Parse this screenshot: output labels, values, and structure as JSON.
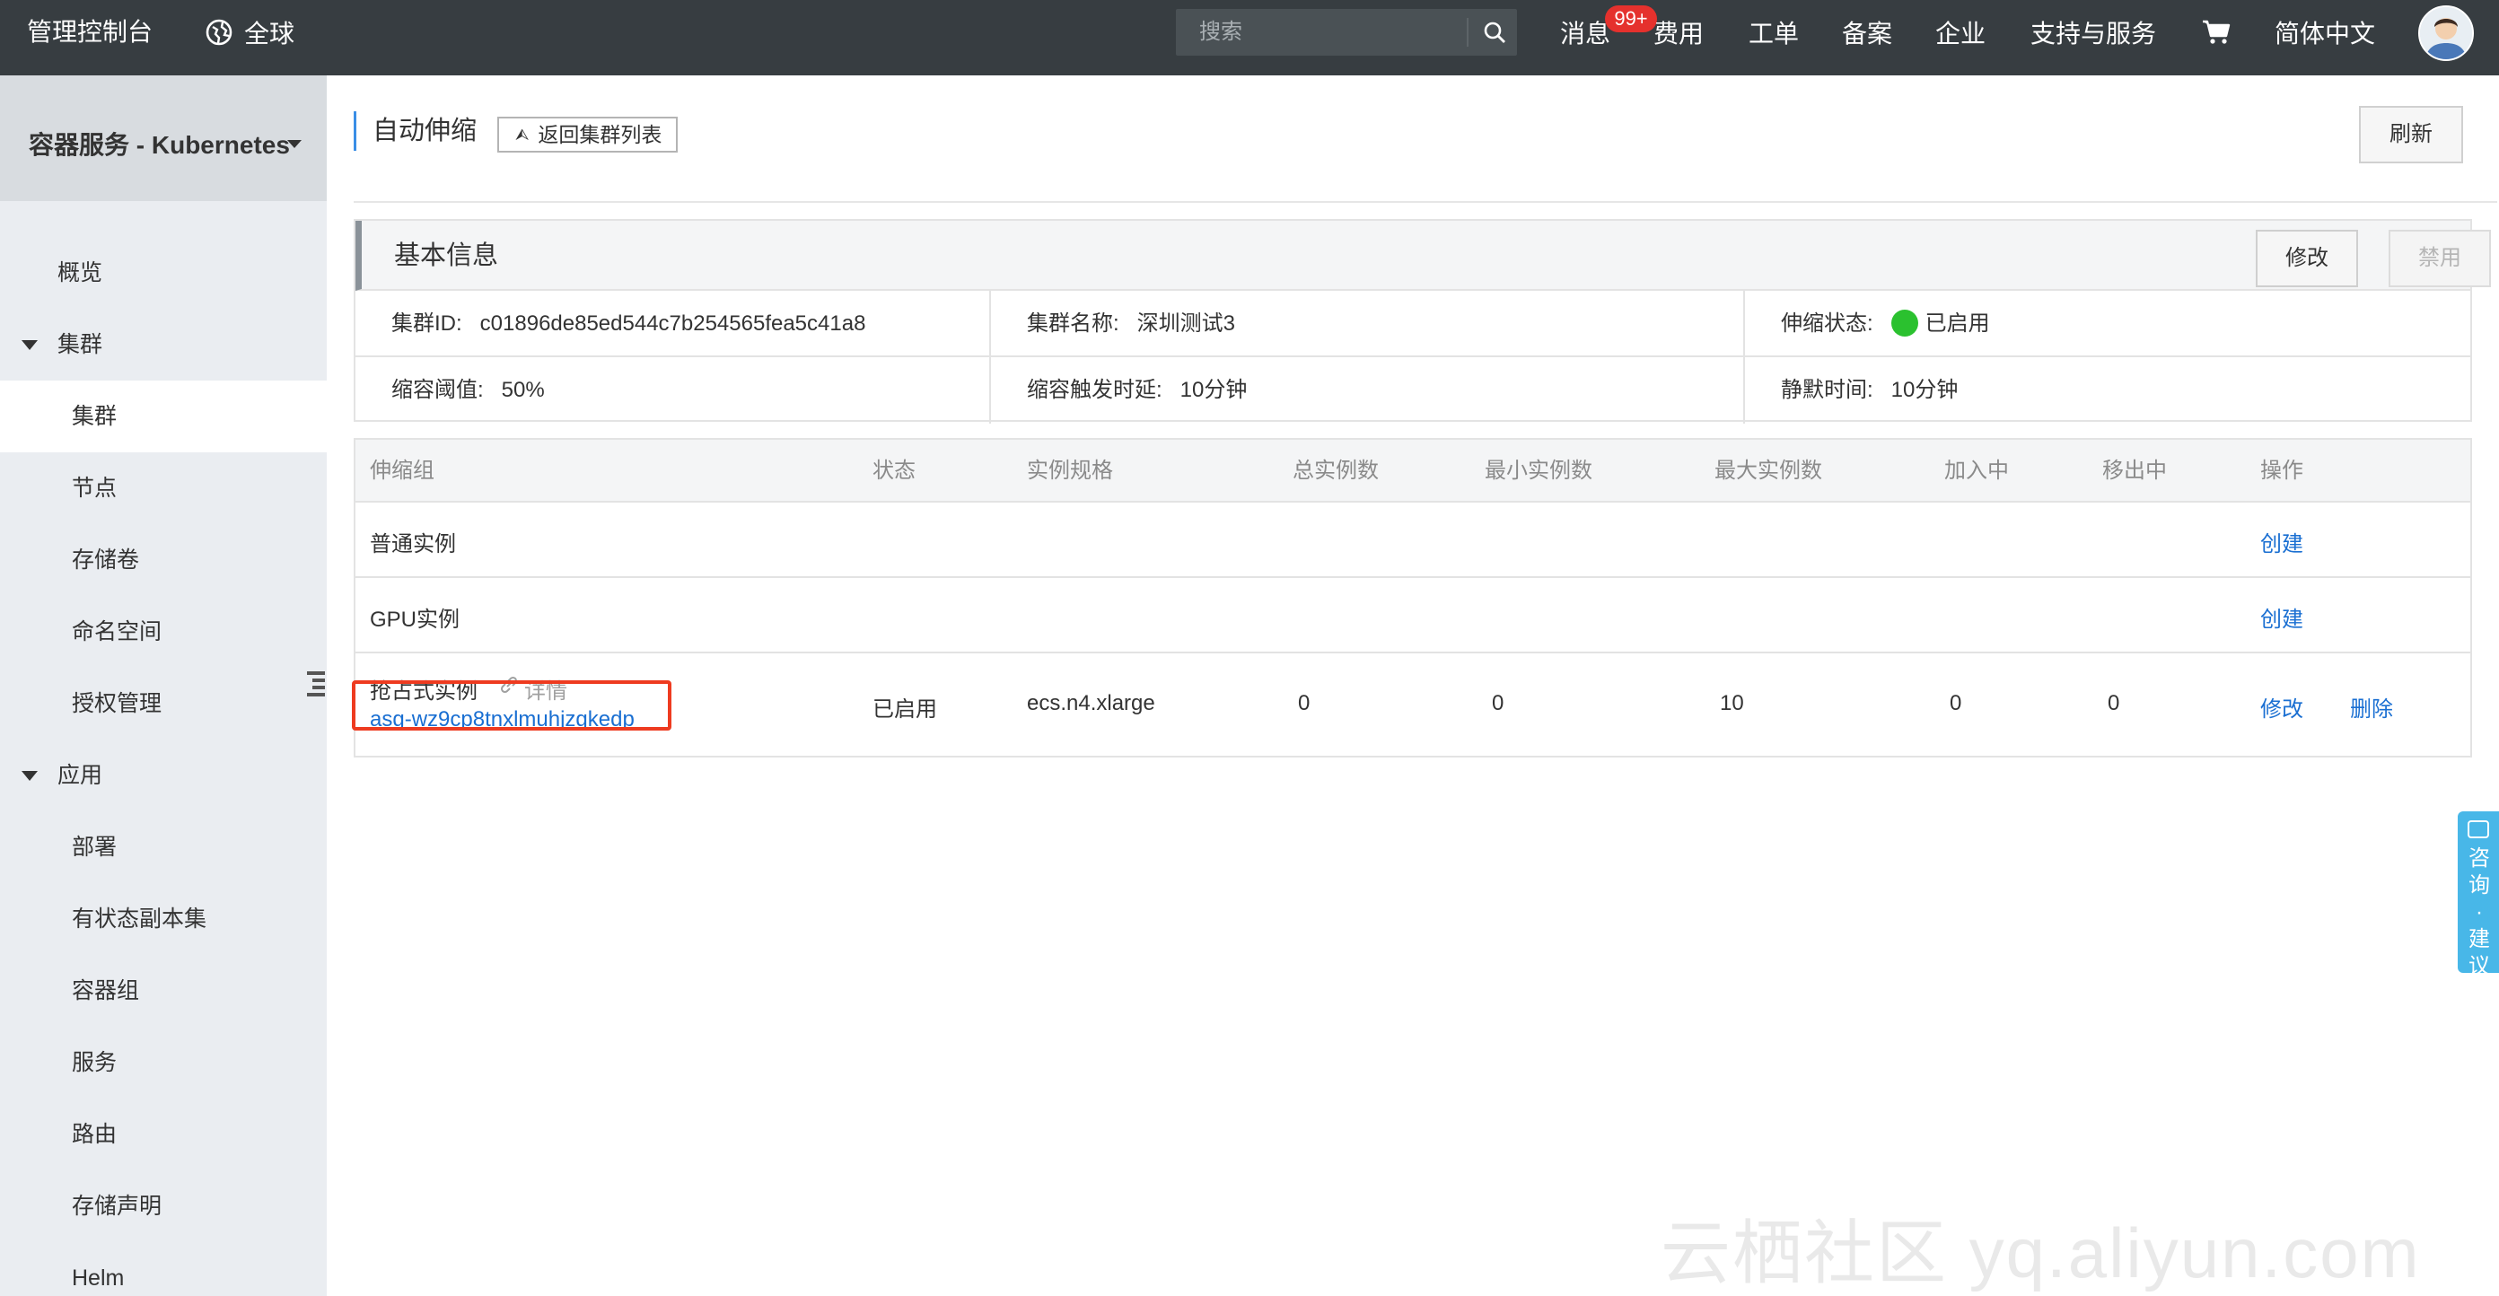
{
  "topbar": {
    "brand": "管理控制台",
    "region": "全球",
    "search_placeholder": "搜索",
    "nav": {
      "messages": "消息",
      "messages_badge": "99+",
      "billing": "费用",
      "tickets": "工单",
      "filing": "备案",
      "enterprise": "企业",
      "support": "支持与服务",
      "language": "简体中文"
    }
  },
  "sidebar": {
    "title": "容器服务 - Kubernetes",
    "items": [
      {
        "label": "概览"
      },
      {
        "label": "集群"
      },
      {
        "label": "集群"
      },
      {
        "label": "节点"
      },
      {
        "label": "存储卷"
      },
      {
        "label": "命名空间"
      },
      {
        "label": "授权管理"
      },
      {
        "label": "应用"
      },
      {
        "label": "部署"
      },
      {
        "label": "有状态副本集"
      },
      {
        "label": "容器组"
      },
      {
        "label": "服务"
      },
      {
        "label": "路由"
      },
      {
        "label": "存储声明"
      },
      {
        "label": "Helm"
      }
    ]
  },
  "page": {
    "title": "自动伸缩",
    "back_button": "返回集群列表",
    "refresh_button": "刷新"
  },
  "basic_info": {
    "title": "基本信息",
    "edit_button": "修改",
    "disable_button": "禁用",
    "cluster_id_label": "集群ID:",
    "cluster_id": "c01896de85ed544c7b254565fea5c41a8",
    "cluster_name_label": "集群名称:",
    "cluster_name": "深圳测试3",
    "scaling_status_label": "伸缩状态:",
    "scaling_status": "已启用",
    "scale_down_threshold_label": "缩容阈值:",
    "scale_down_threshold": "50%",
    "scale_down_delay_label": "缩容触发时延:",
    "scale_down_delay": "10分钟",
    "cooldown_label": "静默时间:",
    "cooldown": "10分钟",
    "status_color": "#2bc12f"
  },
  "groups_table": {
    "headers": [
      "伸缩组",
      "状态",
      "实例规格",
      "总实例数",
      "最小实例数",
      "最大实例数",
      "加入中",
      "移出中",
      "操作"
    ],
    "rows": [
      {
        "name": "普通实例",
        "action_create": "创建"
      },
      {
        "name": "GPU实例",
        "action_create": "创建"
      },
      {
        "name": "抢占式实例",
        "detail": "详情",
        "group_id": "asg-wz9cp8tnxlmuhjzgkedp",
        "status": "已启用",
        "spec": "ecs.n4.xlarge",
        "total": "0",
        "min": "0",
        "max": "10",
        "joining": "0",
        "leaving": "0",
        "action_edit": "修改",
        "action_delete": "删除"
      }
    ]
  },
  "float_tab": {
    "label": "咨询·建议"
  },
  "watermark": "云栖社区 yq.aliyun.com",
  "colors": {
    "topbar": "#373d41",
    "sidebar": "#eaedf1",
    "link": "#1a6fd2",
    "highlight_box": "#ee3b20",
    "badge": "#e5312d",
    "float_tab": "#48b7e8"
  }
}
